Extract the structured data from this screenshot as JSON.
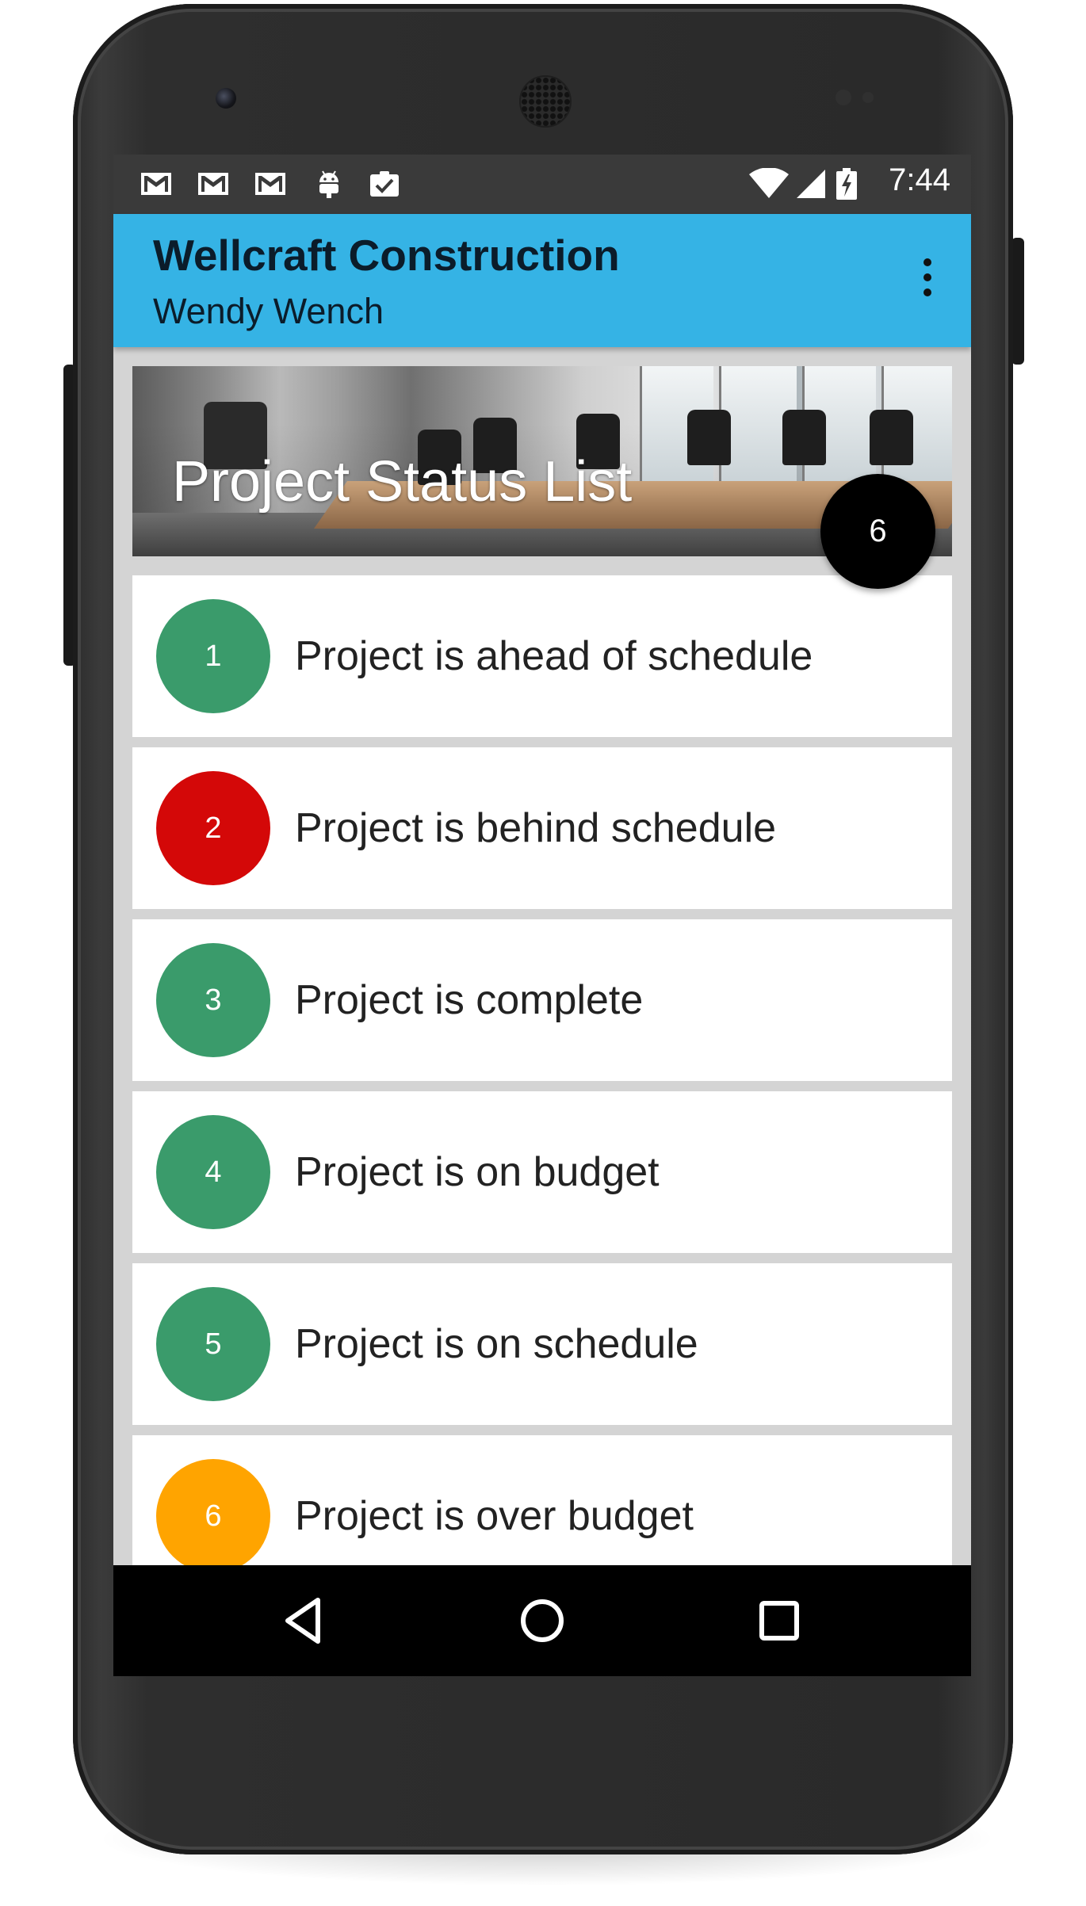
{
  "status_bar": {
    "icons": [
      "gmail-icon",
      "gmail-icon",
      "gmail-icon",
      "android-debug-icon",
      "clipboard-check-icon"
    ],
    "right_icons": [
      "wifi-icon",
      "signal-icon",
      "battery-charging-icon"
    ],
    "time": "7:44"
  },
  "app_bar": {
    "title": "Wellcraft Construction",
    "subtitle": "Wendy Wench",
    "overflow_icon": "more-vert-icon"
  },
  "header": {
    "title": "Project Status List"
  },
  "fab": {
    "label": "6"
  },
  "list": {
    "items": [
      {
        "number": "1",
        "label": "Project is ahead of schedule",
        "color": "#3a9b6b"
      },
      {
        "number": "2",
        "label": "Project is behind schedule",
        "color": "#d40808"
      },
      {
        "number": "3",
        "label": "Project is complete",
        "color": "#3a9b6b"
      },
      {
        "number": "4",
        "label": "Project is on budget",
        "color": "#3a9b6b"
      },
      {
        "number": "5",
        "label": "Project is on schedule",
        "color": "#3a9b6b"
      },
      {
        "number": "6",
        "label": "Project is over budget",
        "color": "#ffa400"
      }
    ]
  },
  "nav_bar": {
    "buttons": [
      "back-icon",
      "home-icon",
      "recents-icon"
    ]
  },
  "colors": {
    "app_bar": "#35b3e5",
    "status_bar": "#3a3a3a",
    "content_background": "#d4d4d4",
    "fab": "#000000"
  }
}
